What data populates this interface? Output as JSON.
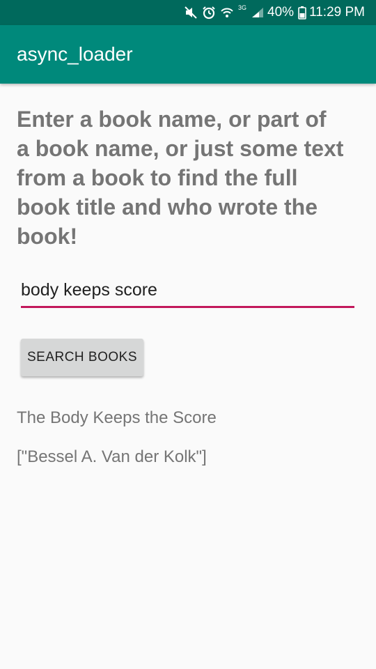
{
  "status_bar": {
    "battery": "40%",
    "time": "11:29 PM",
    "network_label": "3G",
    "icons": [
      "mute-icon",
      "alarm-icon",
      "wifi-icon",
      "network-type-icon",
      "signal-icon",
      "battery-icon"
    ]
  },
  "app_bar": {
    "title": "async_loader",
    "color": "#00897b"
  },
  "main": {
    "instructions": "Enter a book name, or part of a book name, or just some text from a book to find the full book title and who wrote the book!",
    "search": {
      "value": "body keeps score",
      "placeholder": ""
    },
    "search_button_label": "SEARCH BOOKS",
    "result_title": "The Body Keeps the Score",
    "result_author": "[\"Bessel A. Van der Kolk\"]"
  },
  "colors": {
    "status_bar": "#00695c",
    "accent": "#c2185b",
    "background": "#fafafa"
  }
}
